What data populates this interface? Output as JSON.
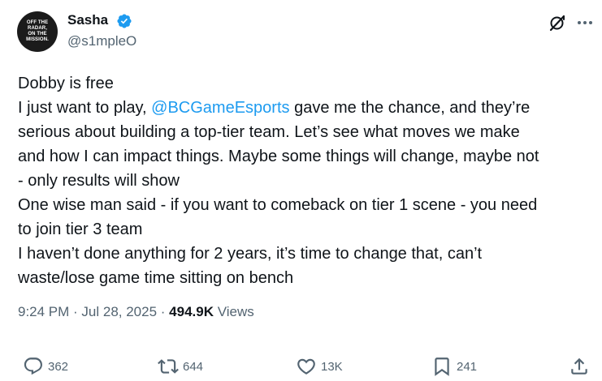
{
  "author": {
    "avatar_text_line1": "OFF THE RADAR,",
    "avatar_text_line2": "ON THE MISSION.",
    "display_name": "Sasha",
    "handle": "@s1mpleO"
  },
  "tweet": {
    "lines": [
      {
        "text": "Dobby is free"
      },
      {
        "pre": "I just want to play, ",
        "mention": "@BCGameEsports",
        "post": " gave me the chance, and they’re"
      },
      {
        "text": "serious about building a top-tier team. Let’s see what moves we make"
      },
      {
        "text": "and how I can impact things. Maybe some things will change, maybe not"
      },
      {
        "text": "- only results will show"
      },
      {
        "text": "One wise man said - if you want to comeback on tier 1 scene - you need"
      },
      {
        "text": "to join tier 3 team"
      },
      {
        "text": "I haven’t done anything for 2 years, it’s time to change that, can’t"
      },
      {
        "text": "waste/lose game time sitting on bench"
      }
    ]
  },
  "meta": {
    "time": "9:24 PM",
    "separator": " · ",
    "date": "Jul 28, 2025",
    "views_count": "494.9K",
    "views_label": " Views"
  },
  "actions": {
    "replies": "362",
    "reposts": "644",
    "likes": "13K",
    "bookmarks": "241"
  },
  "colors": {
    "accent": "#1d9bf0",
    "text": "#0f1419",
    "secondary": "#536471"
  },
  "icons": [
    "verified-badge-icon",
    "grok-icon",
    "more-icon",
    "reply-icon",
    "repost-icon",
    "like-icon",
    "bookmark-icon",
    "share-icon"
  ]
}
